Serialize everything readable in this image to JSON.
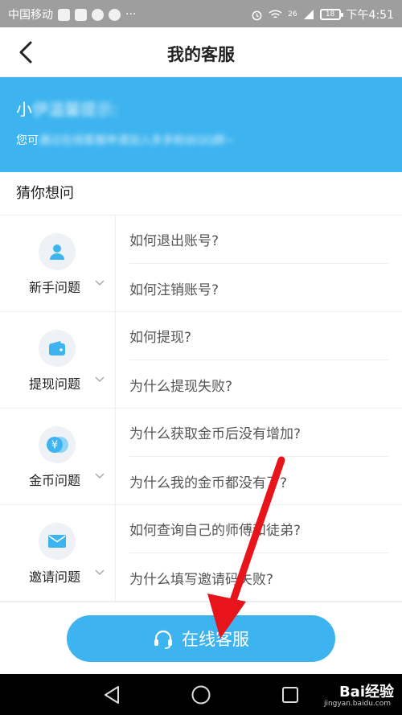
{
  "status_bar": {
    "carrier": "中国移动",
    "battery": "18",
    "time": "下午4:51",
    "signal": "26"
  },
  "header": {
    "title": "我的客服"
  },
  "banner": {
    "title_visible": "小",
    "title_blurred": "伊温馨提示:",
    "sub_visible": "您可",
    "sub_blurred": "通过在线客服申请加入多多粉丝QQ群~",
    "color": "#3db4ef"
  },
  "section": {
    "title": "猜你想问"
  },
  "faq": [
    {
      "category": "新手问题",
      "icon": "user-icon",
      "questions": [
        "如何退出账号?",
        "如何注销账号?"
      ]
    },
    {
      "category": "提现问题",
      "icon": "wallet-icon",
      "questions": [
        "如何提现?",
        "为什么提现失败?"
      ]
    },
    {
      "category": "金币问题",
      "icon": "coin-icon",
      "questions": [
        "为什么获取金币后没有增加?",
        "为什么我的金币都没有了?"
      ]
    },
    {
      "category": "邀请问题",
      "icon": "mail-icon",
      "questions": [
        "如何查询自己的师傅和徒弟?",
        "为什么填写邀请码失败?"
      ]
    }
  ],
  "action": {
    "label": "在线客服",
    "icon": "headset-icon"
  },
  "watermark": {
    "brand": "Bai经验",
    "url": "jingyan.baidu.com"
  },
  "colors": {
    "accent": "#3db4ef",
    "arrow": "#e8141c"
  }
}
